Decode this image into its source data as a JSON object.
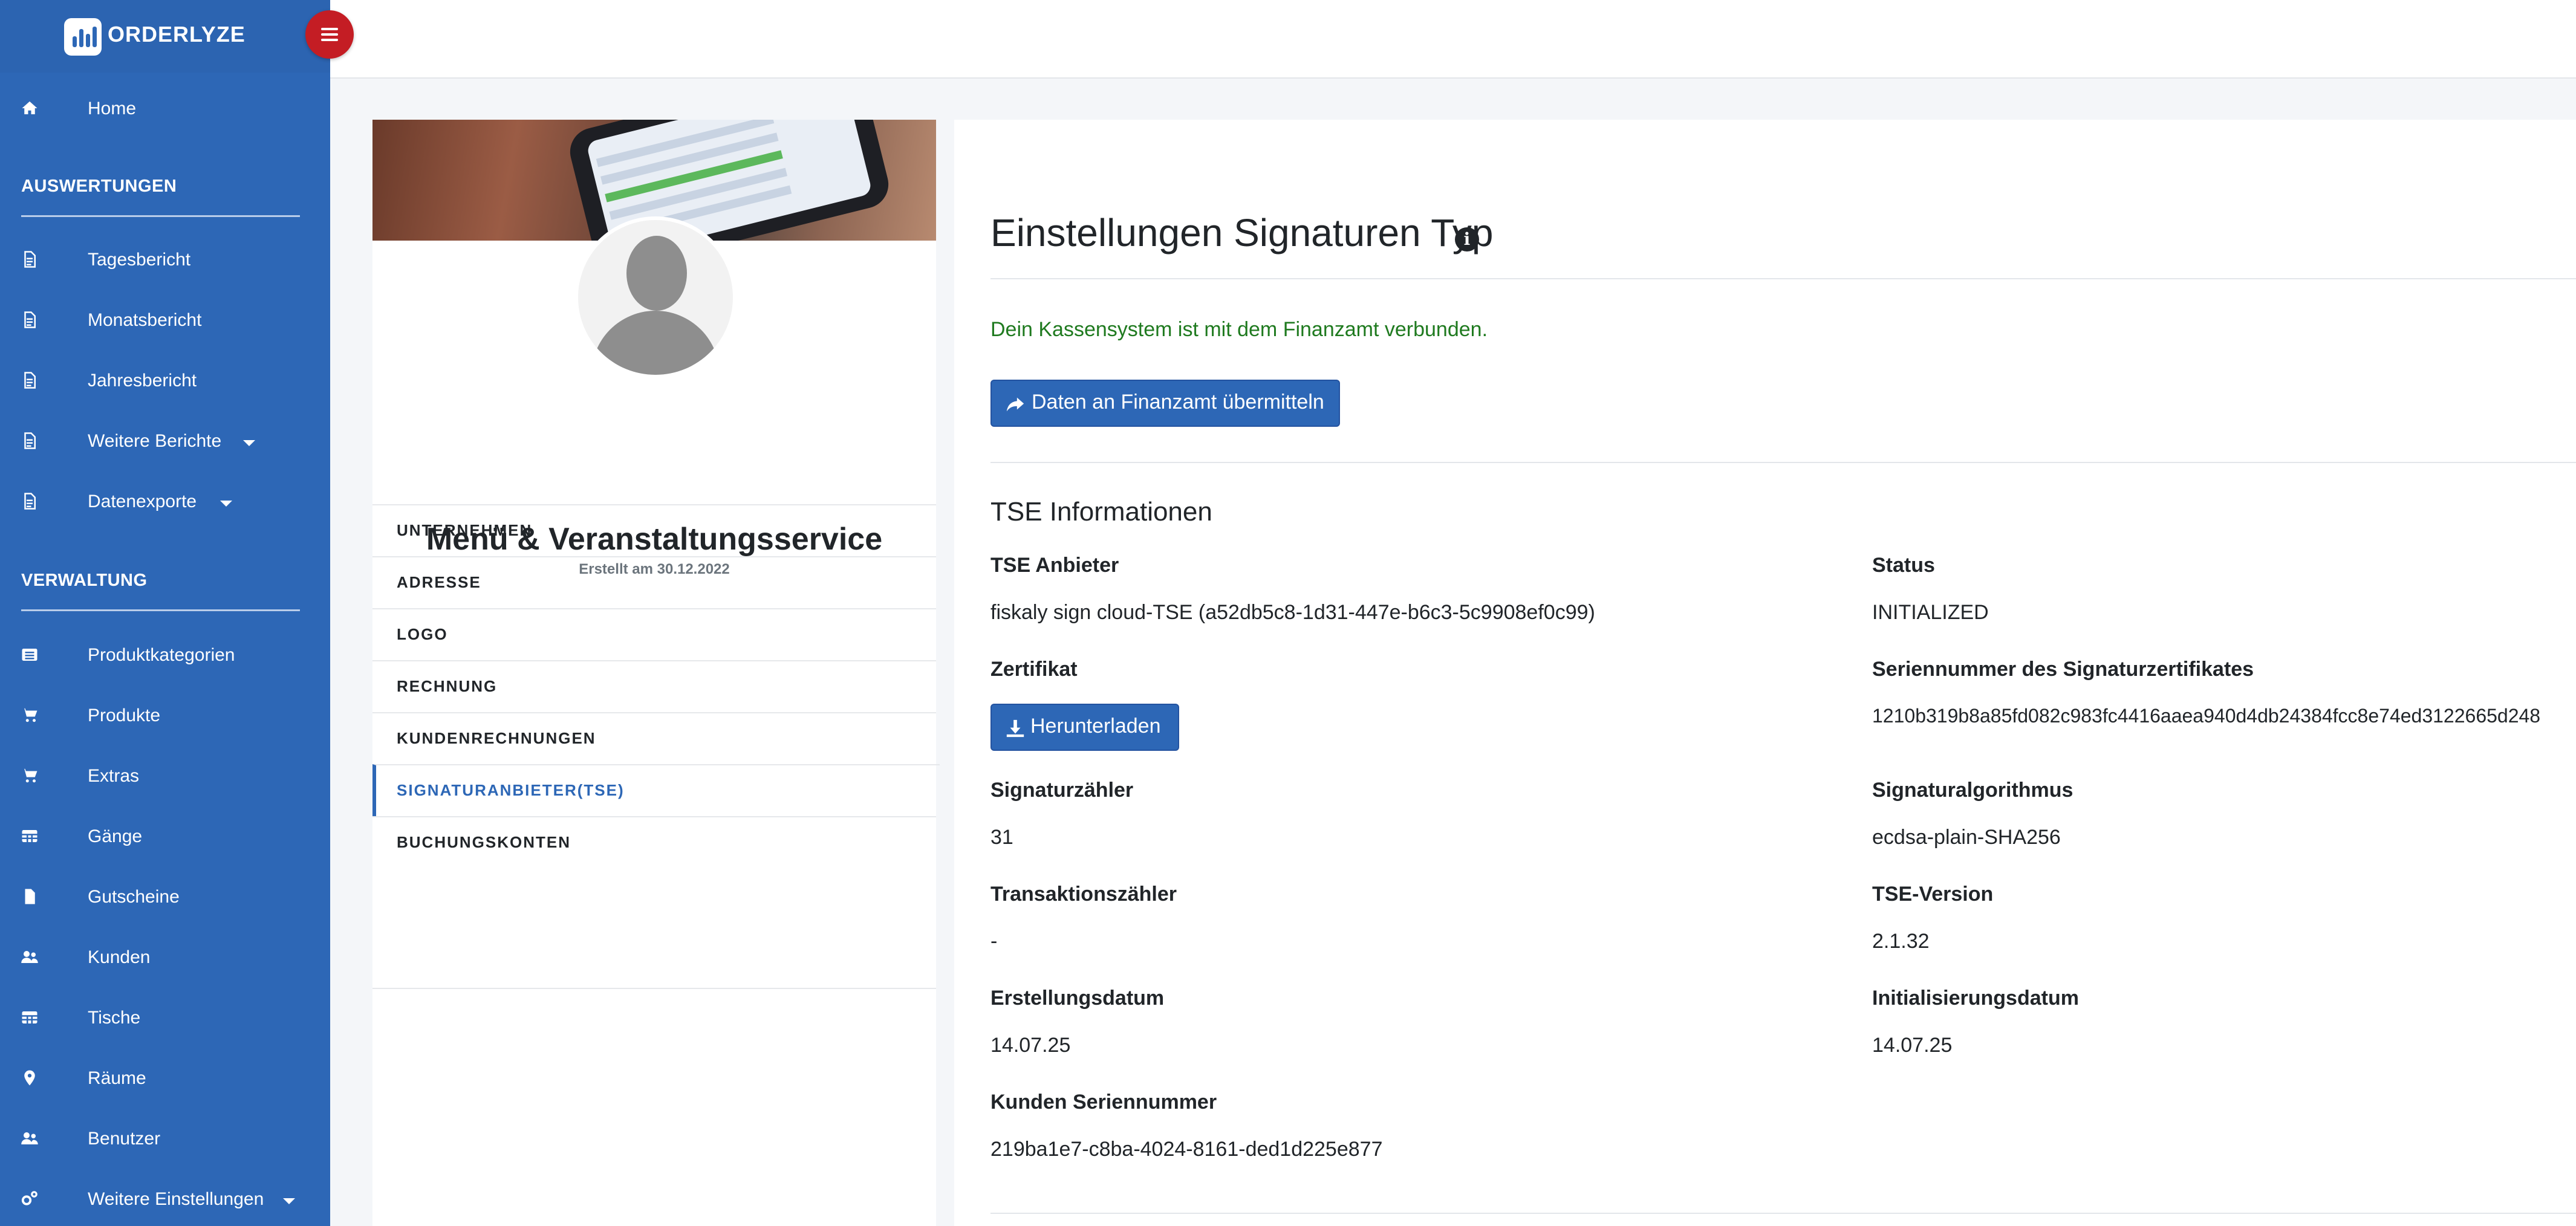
{
  "brand": {
    "name": "ORDERLYZE",
    "logo_icon": "bar-chart-logo-icon"
  },
  "colors": {
    "sidebar": "#2d67b6",
    "accent": "#2d67b6",
    "toggle": "#c41d24",
    "success_text": "#1f7a1f"
  },
  "sidebar": {
    "home": {
      "label": "Home",
      "icon": "home-icon"
    },
    "section_reports": "AUSWERTUNGEN",
    "reports": [
      {
        "label": "Tagesbericht",
        "icon": "file-icon"
      },
      {
        "label": "Monatsbericht",
        "icon": "file-icon"
      },
      {
        "label": "Jahresbericht",
        "icon": "file-icon"
      },
      {
        "label": "Weitere Berichte",
        "icon": "file-icon"
      },
      {
        "label": "Datenexporte",
        "icon": "file-icon"
      }
    ],
    "section_admin": "VERWALTUNG",
    "admin": [
      {
        "label": "Produktkategorien",
        "icon": "list-icon"
      },
      {
        "label": "Produkte",
        "icon": "cart-icon"
      },
      {
        "label": "Extras",
        "icon": "cart-icon"
      },
      {
        "label": "Gänge",
        "icon": "table-icon"
      },
      {
        "label": "Gutscheine",
        "icon": "file-icon"
      },
      {
        "label": "Kunden",
        "icon": "users-icon"
      },
      {
        "label": "Tische",
        "icon": "table-icon"
      },
      {
        "label": "Räume",
        "icon": "map-marker-icon"
      },
      {
        "label": "Benutzer",
        "icon": "users-icon"
      },
      {
        "label": "Weitere Einstellungen",
        "icon": "gears-icon"
      }
    ]
  },
  "profile": {
    "name": "Menü & Veranstaltungsservice",
    "created": "Erstellt am 30.12.2022",
    "tabs": [
      {
        "label": "UNTERNEHMEN"
      },
      {
        "label": "ADRESSE"
      },
      {
        "label": "LOGO"
      },
      {
        "label": "RECHNUNG"
      },
      {
        "label": "KUNDENRECHNUNGEN"
      },
      {
        "label": "SIGNATURANBIETER(TSE)",
        "active": true
      },
      {
        "label": "BUCHUNGSKONTEN"
      }
    ]
  },
  "main": {
    "title": "Einstellungen Signaturen Typ",
    "connected_text": "Dein Kassensystem ist mit dem Finanzamt verbunden.",
    "submit_button": "Daten an Finanzamt übermitteln",
    "tse_section_title": "TSE Informationen",
    "fields": {
      "anbieter_label": "TSE Anbieter",
      "anbieter_value": "fiskaly sign cloud-TSE (a52db5c8-1d31-447e-b6c3-5c9908ef0c99)",
      "status_label": "Status",
      "status_value": "INITIALIZED",
      "zertifikat_label": "Zertifikat",
      "download_button": "Herunterladen",
      "serial_label": "Seriennummer des Signaturzertifikates",
      "serial_value": "1210b319b8a85fd082c983fc4416aaea940d4db24384fcc8e74ed3122665d248",
      "sigcount_label": "Signaturzähler",
      "sigcount_value": "31",
      "algo_label": "Signaturalgorithmus",
      "algo_value": "ecdsa-plain-SHA256",
      "txcount_label": "Transaktionszähler",
      "txcount_value": "-",
      "version_label": "TSE-Version",
      "version_value": "2.1.32",
      "created_label": "Erstellungsdatum",
      "created_value": "14.07.25",
      "init_label": "Initialisierungsdatum",
      "init_value": "14.07.25",
      "customer_serial_label": "Kunden Seriennummer",
      "customer_serial_value": "219ba1e7-c8ba-4024-8161-ded1d225e877"
    }
  }
}
